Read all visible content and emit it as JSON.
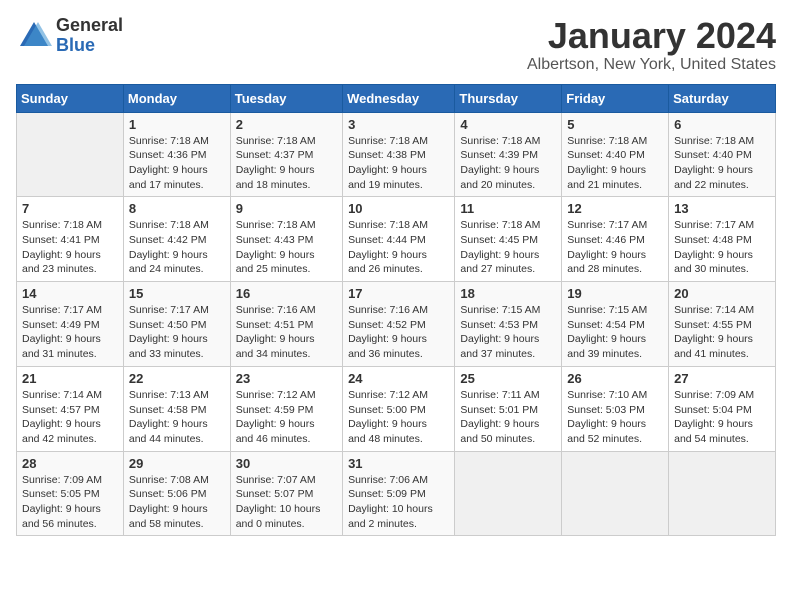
{
  "logo": {
    "general": "General",
    "blue": "Blue"
  },
  "title": "January 2024",
  "location": "Albertson, New York, United States",
  "days_of_week": [
    "Sunday",
    "Monday",
    "Tuesday",
    "Wednesday",
    "Thursday",
    "Friday",
    "Saturday"
  ],
  "weeks": [
    [
      {
        "day": "",
        "info": ""
      },
      {
        "day": "1",
        "info": "Sunrise: 7:18 AM\nSunset: 4:36 PM\nDaylight: 9 hours\nand 17 minutes."
      },
      {
        "day": "2",
        "info": "Sunrise: 7:18 AM\nSunset: 4:37 PM\nDaylight: 9 hours\nand 18 minutes."
      },
      {
        "day": "3",
        "info": "Sunrise: 7:18 AM\nSunset: 4:38 PM\nDaylight: 9 hours\nand 19 minutes."
      },
      {
        "day": "4",
        "info": "Sunrise: 7:18 AM\nSunset: 4:39 PM\nDaylight: 9 hours\nand 20 minutes."
      },
      {
        "day": "5",
        "info": "Sunrise: 7:18 AM\nSunset: 4:40 PM\nDaylight: 9 hours\nand 21 minutes."
      },
      {
        "day": "6",
        "info": "Sunrise: 7:18 AM\nSunset: 4:40 PM\nDaylight: 9 hours\nand 22 minutes."
      }
    ],
    [
      {
        "day": "7",
        "info": "Sunrise: 7:18 AM\nSunset: 4:41 PM\nDaylight: 9 hours\nand 23 minutes."
      },
      {
        "day": "8",
        "info": "Sunrise: 7:18 AM\nSunset: 4:42 PM\nDaylight: 9 hours\nand 24 minutes."
      },
      {
        "day": "9",
        "info": "Sunrise: 7:18 AM\nSunset: 4:43 PM\nDaylight: 9 hours\nand 25 minutes."
      },
      {
        "day": "10",
        "info": "Sunrise: 7:18 AM\nSunset: 4:44 PM\nDaylight: 9 hours\nand 26 minutes."
      },
      {
        "day": "11",
        "info": "Sunrise: 7:18 AM\nSunset: 4:45 PM\nDaylight: 9 hours\nand 27 minutes."
      },
      {
        "day": "12",
        "info": "Sunrise: 7:17 AM\nSunset: 4:46 PM\nDaylight: 9 hours\nand 28 minutes."
      },
      {
        "day": "13",
        "info": "Sunrise: 7:17 AM\nSunset: 4:48 PM\nDaylight: 9 hours\nand 30 minutes."
      }
    ],
    [
      {
        "day": "14",
        "info": "Sunrise: 7:17 AM\nSunset: 4:49 PM\nDaylight: 9 hours\nand 31 minutes."
      },
      {
        "day": "15",
        "info": "Sunrise: 7:17 AM\nSunset: 4:50 PM\nDaylight: 9 hours\nand 33 minutes."
      },
      {
        "day": "16",
        "info": "Sunrise: 7:16 AM\nSunset: 4:51 PM\nDaylight: 9 hours\nand 34 minutes."
      },
      {
        "day": "17",
        "info": "Sunrise: 7:16 AM\nSunset: 4:52 PM\nDaylight: 9 hours\nand 36 minutes."
      },
      {
        "day": "18",
        "info": "Sunrise: 7:15 AM\nSunset: 4:53 PM\nDaylight: 9 hours\nand 37 minutes."
      },
      {
        "day": "19",
        "info": "Sunrise: 7:15 AM\nSunset: 4:54 PM\nDaylight: 9 hours\nand 39 minutes."
      },
      {
        "day": "20",
        "info": "Sunrise: 7:14 AM\nSunset: 4:55 PM\nDaylight: 9 hours\nand 41 minutes."
      }
    ],
    [
      {
        "day": "21",
        "info": "Sunrise: 7:14 AM\nSunset: 4:57 PM\nDaylight: 9 hours\nand 42 minutes."
      },
      {
        "day": "22",
        "info": "Sunrise: 7:13 AM\nSunset: 4:58 PM\nDaylight: 9 hours\nand 44 minutes."
      },
      {
        "day": "23",
        "info": "Sunrise: 7:12 AM\nSunset: 4:59 PM\nDaylight: 9 hours\nand 46 minutes."
      },
      {
        "day": "24",
        "info": "Sunrise: 7:12 AM\nSunset: 5:00 PM\nDaylight: 9 hours\nand 48 minutes."
      },
      {
        "day": "25",
        "info": "Sunrise: 7:11 AM\nSunset: 5:01 PM\nDaylight: 9 hours\nand 50 minutes."
      },
      {
        "day": "26",
        "info": "Sunrise: 7:10 AM\nSunset: 5:03 PM\nDaylight: 9 hours\nand 52 minutes."
      },
      {
        "day": "27",
        "info": "Sunrise: 7:09 AM\nSunset: 5:04 PM\nDaylight: 9 hours\nand 54 minutes."
      }
    ],
    [
      {
        "day": "28",
        "info": "Sunrise: 7:09 AM\nSunset: 5:05 PM\nDaylight: 9 hours\nand 56 minutes."
      },
      {
        "day": "29",
        "info": "Sunrise: 7:08 AM\nSunset: 5:06 PM\nDaylight: 9 hours\nand 58 minutes."
      },
      {
        "day": "30",
        "info": "Sunrise: 7:07 AM\nSunset: 5:07 PM\nDaylight: 10 hours\nand 0 minutes."
      },
      {
        "day": "31",
        "info": "Sunrise: 7:06 AM\nSunset: 5:09 PM\nDaylight: 10 hours\nand 2 minutes."
      },
      {
        "day": "",
        "info": ""
      },
      {
        "day": "",
        "info": ""
      },
      {
        "day": "",
        "info": ""
      }
    ]
  ]
}
